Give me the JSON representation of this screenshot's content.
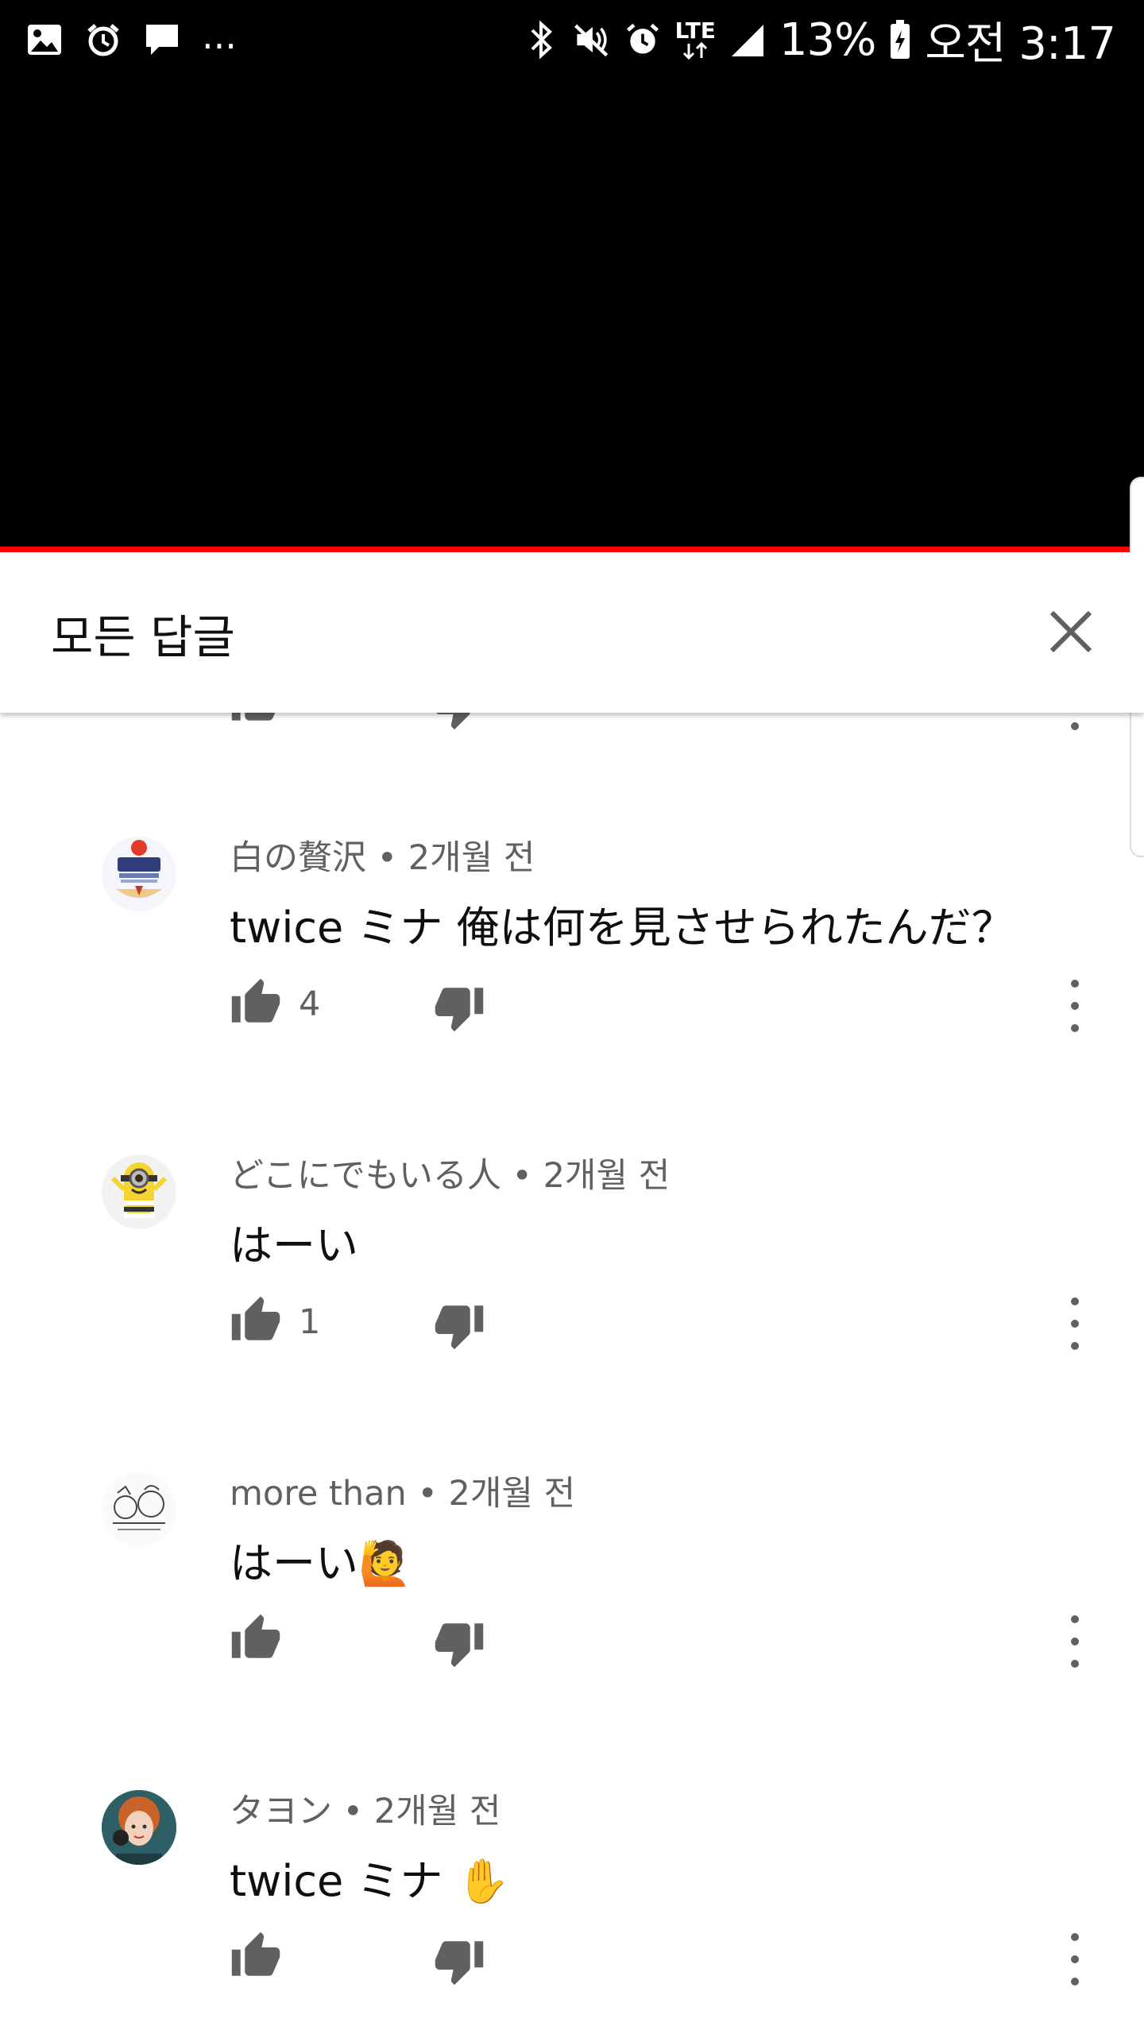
{
  "status_bar": {
    "battery": "13%",
    "time": "오전 3:17",
    "network": "LTE",
    "overflow": "...",
    "icons_left": [
      "gallery-icon",
      "alarm-icon",
      "message-icon"
    ],
    "icons_right": [
      "bluetooth-icon",
      "mute-icon",
      "alarm-icon",
      "lte-icon",
      "signal-icon",
      "battery-icon"
    ]
  },
  "header": {
    "title": "모든 답글",
    "close_icon": "close-icon"
  },
  "colors": {
    "progress": "#ff0000",
    "meta_text": "#606060",
    "body_text": "#0f0f0f"
  },
  "comments": [
    {
      "author": "白の贅沢",
      "time": "2개월 전",
      "separator": "•",
      "text": "twice ミナ 俺は何を見させられたんだ？",
      "likes": "4",
      "avatar": "lipton-tea-avatar"
    },
    {
      "author": "どこにでもいる人",
      "time": "2개월 전",
      "separator": "•",
      "text": "はーい",
      "likes": "1",
      "avatar": "minion-avatar"
    },
    {
      "author": "more than",
      "time": "2개월 전",
      "separator": "•",
      "text": "はーい🙋",
      "likes": "",
      "avatar": "sketch-avatar"
    },
    {
      "author": "タヨン",
      "time": "2개월 전",
      "separator": "•",
      "text": "twice ミナ ✋",
      "likes": "",
      "avatar": "photo-avatar"
    }
  ]
}
